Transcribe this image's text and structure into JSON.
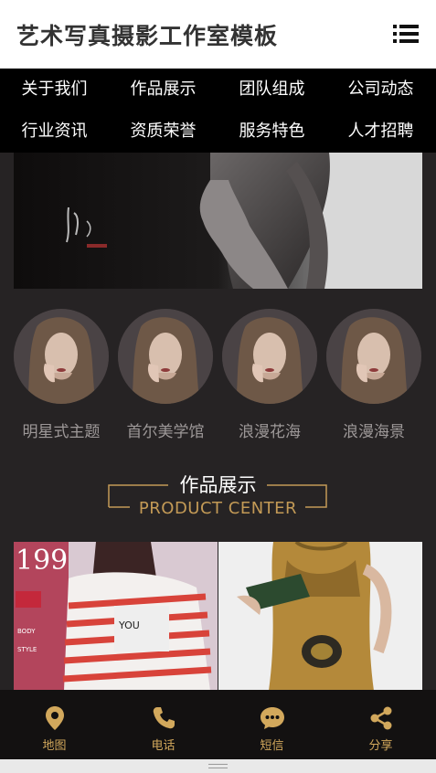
{
  "header": {
    "title": "艺术写真摄影工作室模板",
    "menu_icon": "list-menu-icon"
  },
  "nav": {
    "items": [
      {
        "label": "关于我们"
      },
      {
        "label": "作品展示"
      },
      {
        "label": "团队组成"
      },
      {
        "label": "公司动态"
      },
      {
        "label": "行业资讯"
      },
      {
        "label": "资质荣誉"
      },
      {
        "label": "服务特色"
      },
      {
        "label": "人才招聘"
      }
    ]
  },
  "banner": {
    "image": "black-and-white woman profile portrait"
  },
  "categories": [
    {
      "label": "明星式主题"
    },
    {
      "label": "首尔美学馆"
    },
    {
      "label": "浪漫花海"
    },
    {
      "label": "浪漫海景"
    }
  ],
  "section": {
    "title": "作品展示",
    "subtitle": "PRODUCT CENTER"
  },
  "products": [
    {
      "image": "magazine cover woman striped shirt"
    },
    {
      "image": "model holding beaded clutch"
    }
  ],
  "footer": {
    "items": [
      {
        "label": "地图",
        "icon": "map-pin-icon"
      },
      {
        "label": "电话",
        "icon": "phone-icon"
      },
      {
        "label": "短信",
        "icon": "message-icon"
      },
      {
        "label": "分享",
        "icon": "share-icon"
      }
    ]
  },
  "colors": {
    "background": "#262324",
    "nav_background": "#000000",
    "accent_gold": "#c39a56",
    "footer_background": "#131111"
  }
}
